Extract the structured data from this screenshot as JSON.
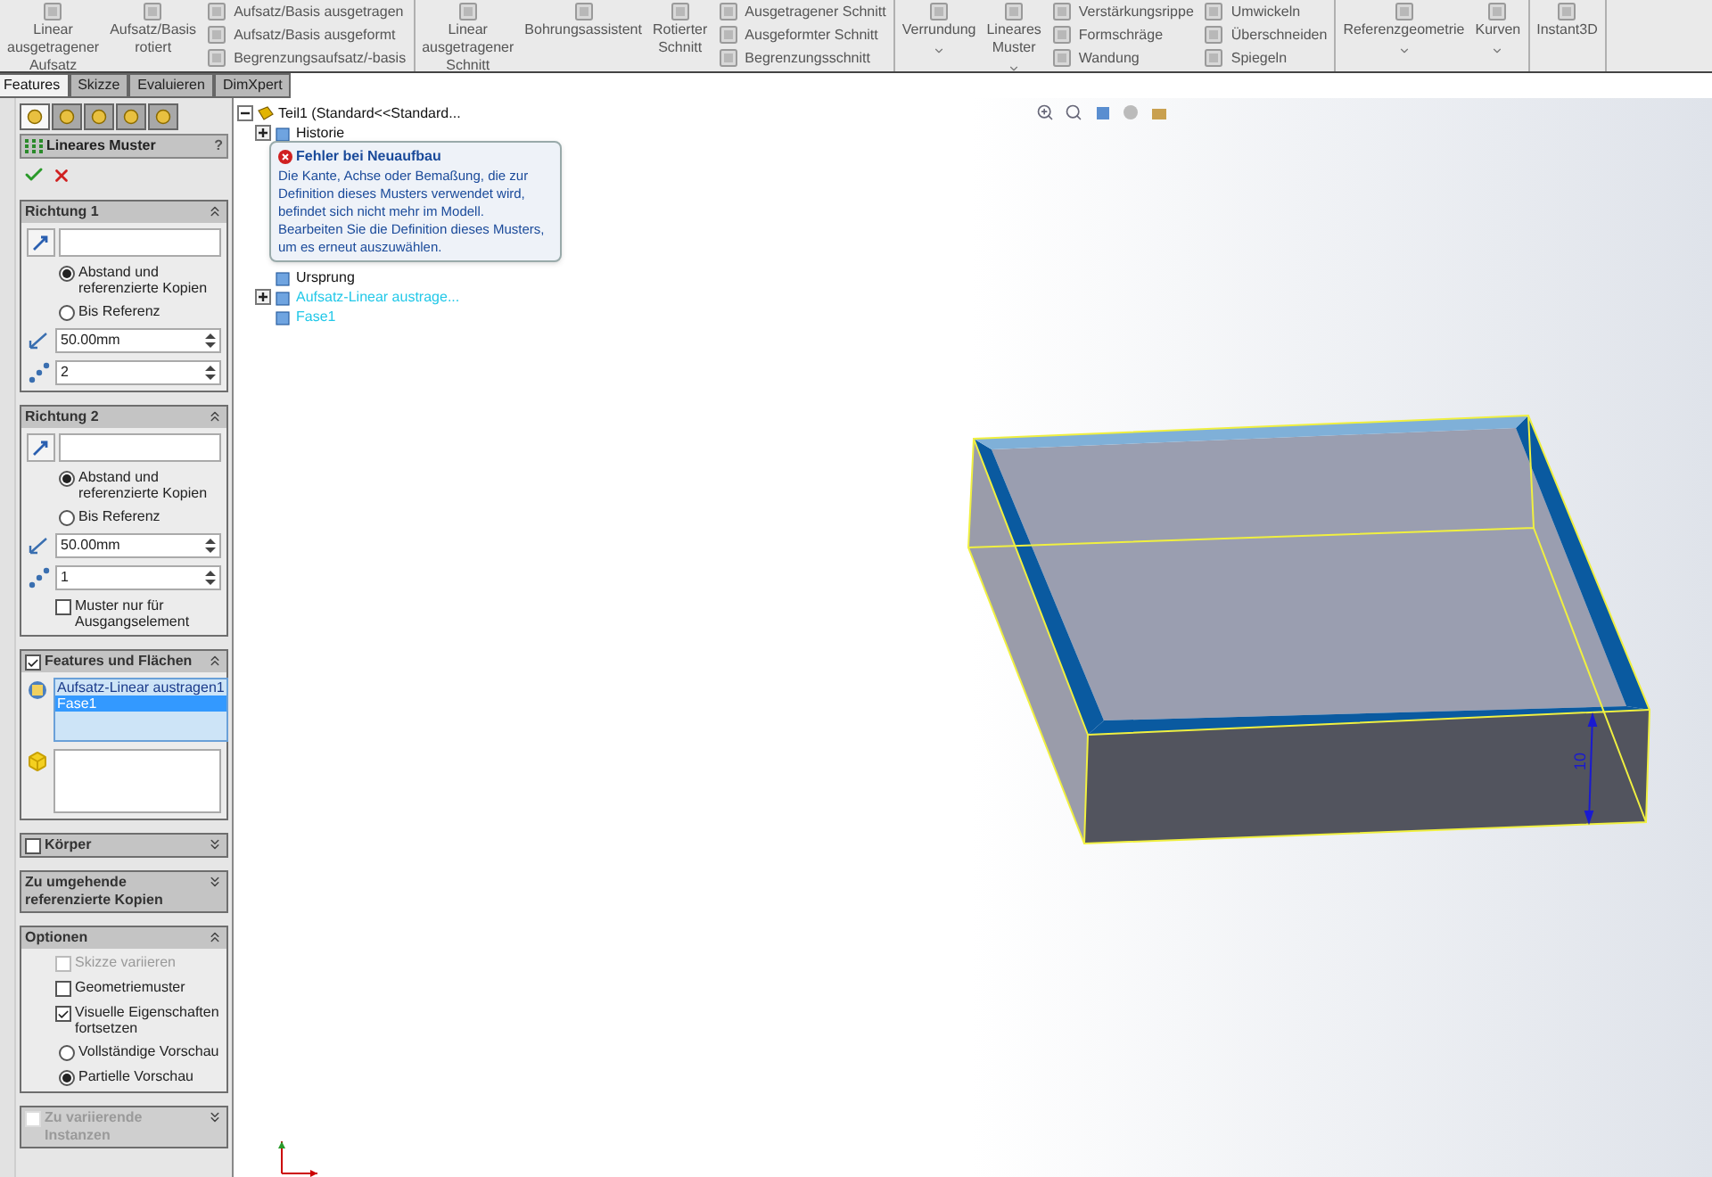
{
  "ribbon": {
    "groups": [
      {
        "columns": [
          {
            "kind": "large",
            "label": "Linear ausgetragener Aufsatz",
            "dropdown": false
          },
          {
            "kind": "large",
            "label": "Aufsatz/Basis rotiert",
            "dropdown": false
          },
          {
            "kind": "stack",
            "items": [
              "Aufsatz/Basis ausgetragen",
              "Aufsatz/Basis ausgeformt",
              "Begrenzungsaufsatz/-basis"
            ]
          }
        ]
      },
      {
        "columns": [
          {
            "kind": "large",
            "label": "Linear ausgetragener Schnitt",
            "dropdown": false
          },
          {
            "kind": "large",
            "label": "Bohrungsassistent",
            "dropdown": false
          },
          {
            "kind": "large",
            "label": "Rotierter Schnitt",
            "dropdown": false
          },
          {
            "kind": "stack",
            "items": [
              "Ausgetragener Schnitt",
              "Ausgeformter Schnitt",
              "Begrenzungsschnitt"
            ]
          }
        ]
      },
      {
        "columns": [
          {
            "kind": "large",
            "label": "Verrundung",
            "dropdown": true
          },
          {
            "kind": "large",
            "label": "Lineares Muster",
            "dropdown": true
          },
          {
            "kind": "stack",
            "items": [
              "Verstärkungsrippe",
              "Formschräge",
              "Wandung"
            ]
          },
          {
            "kind": "stack",
            "items": [
              "Umwickeln",
              "Überschneiden",
              "Spiegeln"
            ]
          }
        ]
      },
      {
        "columns": [
          {
            "kind": "large",
            "label": "Referenzgeometrie",
            "dropdown": true
          },
          {
            "kind": "large",
            "label": "Kurven",
            "dropdown": true
          }
        ]
      },
      {
        "columns": [
          {
            "kind": "large",
            "label": "Instant3D",
            "dropdown": false
          }
        ]
      }
    ]
  },
  "tabs": [
    {
      "label": "Features",
      "selected": true
    },
    {
      "label": "Skizze",
      "selected": false
    },
    {
      "label": "Evaluieren",
      "selected": false
    },
    {
      "label": "DimXpert",
      "selected": false
    }
  ],
  "manager_tabs": [
    {
      "selected": true
    },
    {
      "selected": false
    },
    {
      "selected": false
    },
    {
      "selected": false
    },
    {
      "selected": false
    }
  ],
  "property_manager": {
    "title": "Lineares Muster",
    "help": "?",
    "sections": [
      {
        "title": "Richtung 1",
        "expanded": true,
        "disabled": false,
        "controls": [
          {
            "kind": "selection"
          },
          {
            "kind": "radio",
            "label": "Abstand und referenzierte Kopien",
            "selected": true
          },
          {
            "kind": "radio",
            "label": "Bis Referenz",
            "selected": false
          },
          {
            "kind": "distance",
            "value": "50.00mm"
          },
          {
            "kind": "count",
            "value": "2"
          }
        ]
      },
      {
        "title": "Richtung 2",
        "expanded": true,
        "disabled": false,
        "controls": [
          {
            "kind": "selection"
          },
          {
            "kind": "radio",
            "label": "Abstand und referenzierte Kopien",
            "selected": true
          },
          {
            "kind": "radio",
            "label": "Bis Referenz",
            "selected": false
          },
          {
            "kind": "distance",
            "value": "50.00mm"
          },
          {
            "kind": "count",
            "value": "1"
          },
          {
            "kind": "checkbox",
            "label": "Muster nur für Ausgangselement",
            "checked": false,
            "disabled": false
          }
        ]
      },
      {
        "title": "Features und Flächen",
        "expanded": true,
        "disabled": false,
        "header_check": true,
        "controls": [
          {
            "kind": "features",
            "items": [
              {
                "label": "Aufsatz-Linear austragen1",
                "selected": false
              },
              {
                "label": "Fase1",
                "selected": true
              }
            ]
          },
          {
            "kind": "bodies"
          }
        ]
      },
      {
        "title": "Körper",
        "expanded": false,
        "disabled": false,
        "header_check": false
      },
      {
        "title": "Zu umgehende referenzierte Kopien",
        "expanded": false,
        "disabled": false
      },
      {
        "title": "Optionen",
        "expanded": true,
        "disabled": false,
        "controls": [
          {
            "kind": "checkbox",
            "label": "Skizze variieren",
            "checked": false,
            "disabled": true
          },
          {
            "kind": "checkbox",
            "label": "Geometriemuster",
            "checked": false,
            "disabled": false
          },
          {
            "kind": "checkbox",
            "label": "Visuelle Eigenschaften fortsetzen",
            "checked": true,
            "disabled": false
          },
          {
            "kind": "radio",
            "label": "Vollständige Vorschau",
            "selected": false
          },
          {
            "kind": "radio",
            "label": "Partielle Vorschau",
            "selected": true
          }
        ]
      },
      {
        "title": "Zu variierende Instanzen",
        "expanded": false,
        "disabled": true,
        "header_check": false
      }
    ]
  },
  "tree": {
    "items": [
      {
        "label": "Teil1 (Standard<<Standard...",
        "expanded": true,
        "highlighted": false,
        "children": [
          {
            "label": "Historie",
            "expanded": false,
            "highlighted": false
          },
          {
            "label": "Ursprung",
            "highlighted": false
          },
          {
            "label": "Aufsatz-Linear austrage...",
            "expanded": false,
            "highlighted": true
          },
          {
            "label": "Fase1",
            "highlighted": true
          }
        ]
      }
    ]
  },
  "tooltip": {
    "title": "Fehler bei Neuaufbau",
    "text": "Die Kante, Achse oder Bemaßung, die zur Definition dieses Musters verwendet wird, befindet sich nicht mehr im Modell.  Bearbeiten Sie die Definition dieses Musters, um es erneut auszuwählen."
  },
  "model": {
    "dimension": "10"
  }
}
